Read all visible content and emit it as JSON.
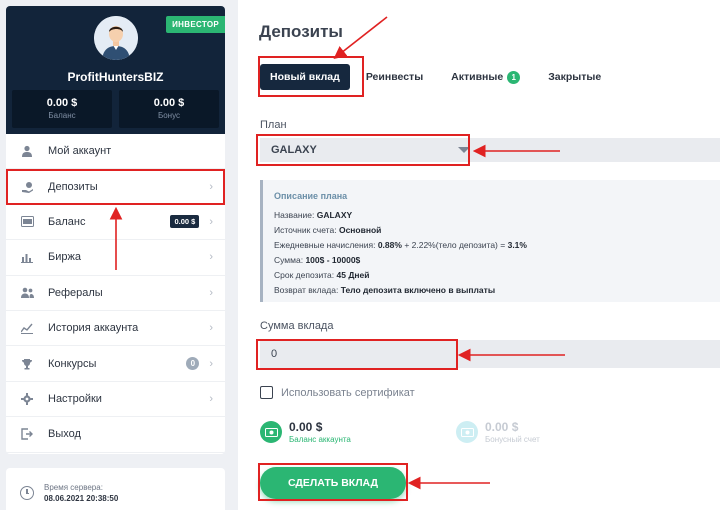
{
  "sidebar": {
    "badge": "ИНВЕСТОР",
    "username": "ProfitHuntersBIZ",
    "balance": {
      "value": "0.00 $",
      "label": "Баланс"
    },
    "bonus": {
      "value": "0.00 $",
      "label": "Бонус"
    },
    "menu": [
      {
        "label": "Мой аккаунт",
        "icon": "user-icon"
      },
      {
        "label": "Депозиты",
        "icon": "deposit-icon"
      },
      {
        "label": "Баланс",
        "icon": "wallet-icon",
        "pill": "0.00 $"
      },
      {
        "label": "Биржа",
        "icon": "chart-icon"
      },
      {
        "label": "Рефералы",
        "icon": "users-icon"
      },
      {
        "label": "История аккаунта",
        "icon": "history-icon"
      },
      {
        "label": "Конкурсы",
        "icon": "trophy-icon",
        "pill": "0"
      },
      {
        "label": "Настройки",
        "icon": "gear-icon"
      },
      {
        "label": "Выход",
        "icon": "logout-icon"
      }
    ],
    "server_time": {
      "label": "Время сервера:",
      "value": "08.06.2021 20:38:50"
    }
  },
  "main": {
    "title": "Депозиты",
    "tabs": [
      {
        "label": "Новый вклад"
      },
      {
        "label": "Реинвесты"
      },
      {
        "label": "Активные",
        "count": "1"
      },
      {
        "label": "Закрытые"
      }
    ],
    "plan_label": "План",
    "plan_value": "GALAXY",
    "plan_description": {
      "title": "Описание плана",
      "name_label": "Название:",
      "name": "GALAXY",
      "source_label": "Источник счета:",
      "source": "Основной",
      "daily_label": "Ежедневные начисления:",
      "daily_value": "0.88%",
      "daily_extra": "+ 2.22%(тело депозита) =",
      "daily_total": "3.1%",
      "sum_label": "Сумма:",
      "sum": "100$ - 10000$",
      "term_label": "Срок депозита:",
      "term": "45 Дней",
      "return_label": "Возврат вклада:",
      "return": "Тело депозита включено в выплаты"
    },
    "amount_label": "Сумма вклада",
    "amount_value": "0",
    "certificate_label": "Использовать сертификат",
    "account_balance": {
      "value": "0.00 $",
      "label": "Баланс аккаунта"
    },
    "bonus_account": {
      "value": "0.00 $",
      "label": "Бонусный счет"
    },
    "submit_label": "СДЕЛАТЬ ВКЛАД"
  },
  "colors": {
    "accent": "#2bb673",
    "dark": "#16283e",
    "highlight": "#e02222"
  }
}
